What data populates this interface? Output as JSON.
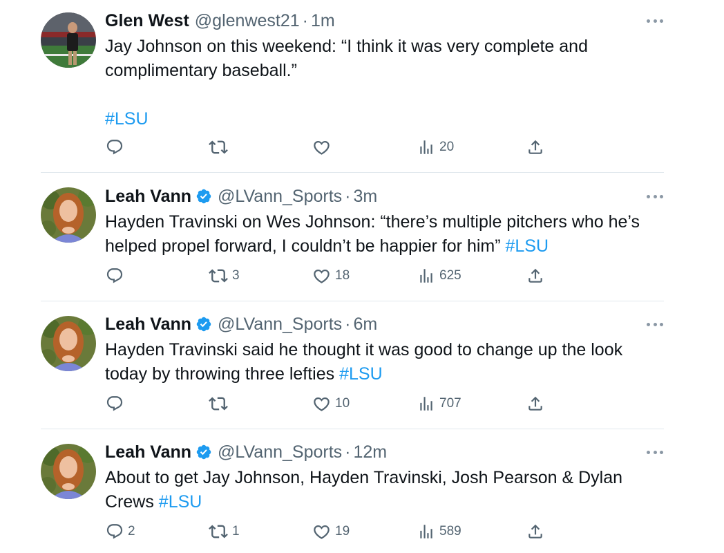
{
  "colors": {
    "accent": "#1d9bf0",
    "secondary_text": "#536471",
    "primary_text": "#0f1419",
    "divider": "#e1e8ed"
  },
  "tweets": [
    {
      "name": "Glen West",
      "handle": "@glenwest21",
      "separator": "·",
      "time": "1m",
      "verified": false,
      "text_line1": "Jay Johnson on this weekend: “I think it was very complete and",
      "text_line2": "complimentary baseball.”",
      "hashtag": "#LSU",
      "replies": "",
      "retweets": "",
      "likes": "",
      "views": "20"
    },
    {
      "name": "Leah Vann",
      "handle": "@LVann_Sports",
      "separator": "·",
      "time": "3m",
      "verified": true,
      "text_line1": "Hayden Travinski on Wes Johnson: “there’s multiple pitchers who he’s",
      "text_line2": "helped propel forward, I couldn’t be happier for him”",
      "hashtag": "#LSU",
      "replies": "",
      "retweets": "3",
      "likes": "18",
      "views": "625"
    },
    {
      "name": "Leah Vann",
      "handle": "@LVann_Sports",
      "separator": "·",
      "time": "6m",
      "verified": true,
      "text_line1": "Hayden Travinski said he thought it was good to change up the look",
      "text_line2": "today by throwing three lefties",
      "hashtag": "#LSU",
      "replies": "",
      "retweets": "",
      "likes": "10",
      "views": "707"
    },
    {
      "name": "Leah Vann",
      "handle": "@LVann_Sports",
      "separator": "·",
      "time": "12m",
      "verified": true,
      "text_line1": "About to get Jay Johnson, Hayden Travinski, Josh Pearson & Dylan",
      "text_line2": "Crews",
      "hashtag": "#LSU",
      "replies": "2",
      "retweets": "1",
      "likes": "19",
      "views": "589"
    }
  ],
  "icons": {
    "reply": "reply-icon",
    "retweet": "retweet-icon",
    "like": "like-icon",
    "views": "views-icon",
    "share": "share-icon",
    "more": "more-icon",
    "verified": "verified-badge-icon"
  }
}
